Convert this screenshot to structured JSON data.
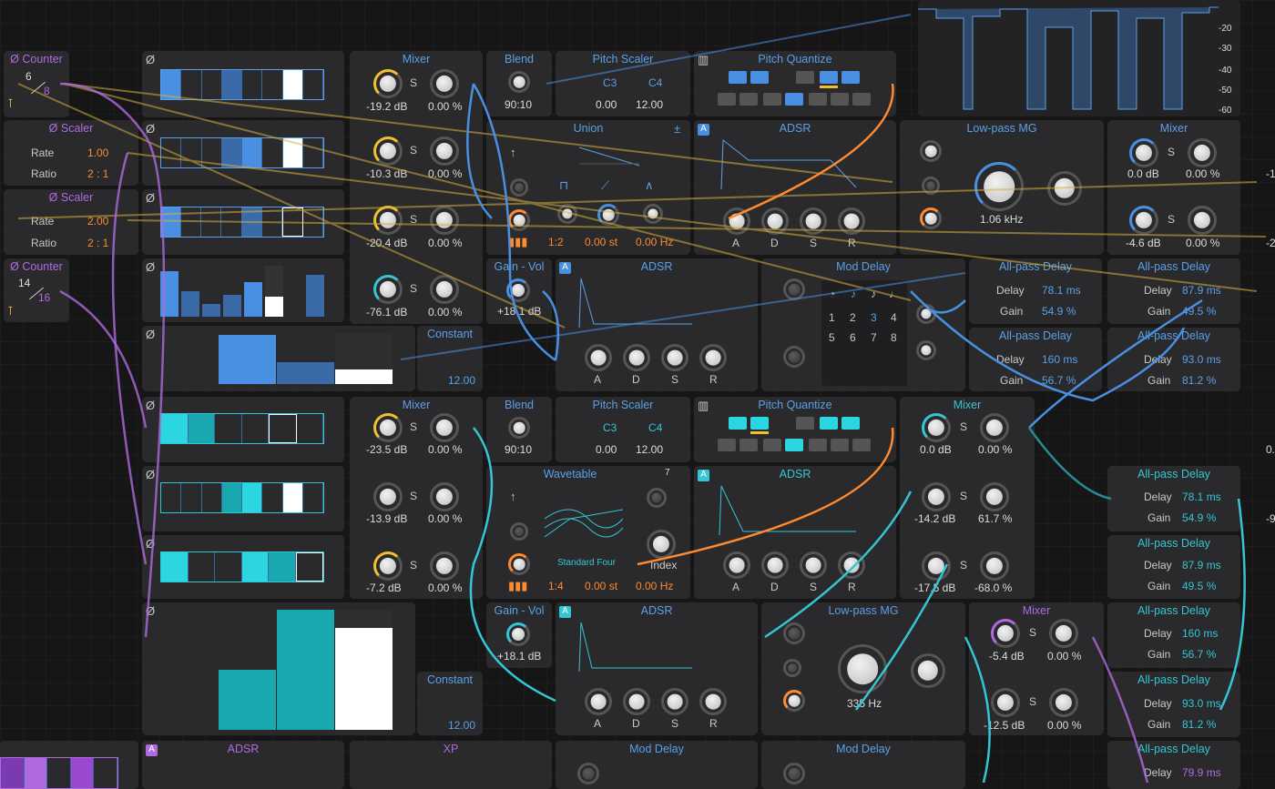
{
  "colors": {
    "background": "#161617",
    "panel": "#2a2a2c",
    "blue": "#5aa0e8",
    "cyan": "#34c6d4",
    "purple": "#b06ae0",
    "orange": "#ff8a30",
    "yellow": "#f0c030",
    "red": "#e03030"
  },
  "counter1": {
    "title": "Ø Counter",
    "top": "6",
    "bottom": "8"
  },
  "scaler1": {
    "title": "Ø Scaler",
    "rate_label": "Rate",
    "rate": "1.00",
    "ratio_label": "Ratio",
    "ratio": "2 : 1"
  },
  "scaler2": {
    "title": "Ø Scaler",
    "rate_label": "Rate",
    "rate": "2.00",
    "ratio_label": "Ratio",
    "ratio": "2 : 1"
  },
  "counter2": {
    "title": "Ø Counter",
    "top": "14",
    "bottom": "16"
  },
  "mixer1": {
    "title": "Mixer",
    "rows": [
      {
        "db": "-19.2 dB",
        "pct": "0.00 %"
      },
      {
        "db": "-10.3 dB",
        "pct": "0.00 %"
      },
      {
        "db": "-20.4 dB",
        "pct": "0.00 %"
      },
      {
        "db": "-76.1 dB",
        "pct": "0.00 %"
      }
    ]
  },
  "mixer2": {
    "title": "Mixer",
    "rows": [
      {
        "db": "-23.5 dB",
        "pct": "0.00 %"
      },
      {
        "db": "-13.9 dB",
        "pct": "0.00 %"
      },
      {
        "db": "-7.2 dB",
        "pct": "0.00 %"
      }
    ]
  },
  "blend1": {
    "title": "Blend",
    "value": "90:10"
  },
  "blend2": {
    "title": "Blend",
    "value": "90:10"
  },
  "pitchscaler1": {
    "title": "Pitch Scaler",
    "low": "C3",
    "high": "C4",
    "v1": "0.00",
    "v2": "12.00"
  },
  "pitchscaler2": {
    "title": "Pitch Scaler",
    "low": "C3",
    "high": "C4",
    "v1": "0.00",
    "v2": "12.00"
  },
  "pq1": {
    "title": "Pitch Quantize"
  },
  "pq2": {
    "title": "Pitch Quantize"
  },
  "union": {
    "title": "Union",
    "ratio": "1:2",
    "st": "0.00 st",
    "hz": "0.00 Hz"
  },
  "wavetable": {
    "title": "Wavetable",
    "table": "Standard Four",
    "index_label": "Index",
    "ratio": "1:4",
    "st": "0.00 st",
    "hz": "0.00 Hz",
    "count": "7"
  },
  "adsr1": {
    "title": "ADSR",
    "labels": [
      "A",
      "D",
      "S",
      "R"
    ]
  },
  "adsr2": {
    "title": "ADSR",
    "labels": [
      "A",
      "D",
      "S",
      "R"
    ]
  },
  "adsr3": {
    "title": "ADSR",
    "labels": [
      "A",
      "D",
      "S",
      "R"
    ]
  },
  "adsr4": {
    "title": "ADSR",
    "labels": [
      "A",
      "D",
      "S",
      "R"
    ]
  },
  "adsr5": {
    "title": "ADSR"
  },
  "lpmg1": {
    "title": "Low-pass MG",
    "freq": "1.06 kHz"
  },
  "lpmg2": {
    "title": "Low-pass MG",
    "freq": "335 Hz"
  },
  "mixer3": {
    "title": "Mixer",
    "rows": [
      {
        "db": "0.0 dB",
        "pct": "0.00 %"
      },
      {
        "db": "-4.6 dB",
        "pct": "0.00 %"
      }
    ]
  },
  "mixer4": {
    "title": "Mixer",
    "rows": [
      {
        "db": "0.0 dB",
        "pct": "0.00 %"
      },
      {
        "db": "-14.2 dB",
        "pct": "61.7 %"
      },
      {
        "db": "-17.5 dB",
        "pct": "-68.0 %"
      }
    ]
  },
  "mixer5": {
    "title": "Mixer",
    "rows": [
      {
        "db": "-5.4 dB",
        "pct": "0.00 %"
      },
      {
        "db": "-12.5 dB",
        "pct": "0.00 %"
      }
    ]
  },
  "gainvol1": {
    "title": "Gain - Vol",
    "value": "+18.1 dB"
  },
  "gainvol2": {
    "title": "Gain - Vol",
    "value": "+18.1 dB"
  },
  "constant1": {
    "title": "Constant",
    "value": "12.00"
  },
  "constant2": {
    "title": "Constant",
    "value": "12.00"
  },
  "moddelay1": {
    "title": "Mod Delay",
    "numbers": [
      "1",
      "2",
      "3",
      "4",
      "5",
      "6",
      "7",
      "8"
    ]
  },
  "moddelay2": {
    "title": "Mod Delay"
  },
  "moddelay3": {
    "title": "Mod Delay"
  },
  "xp": {
    "title": "XP"
  },
  "allpass": [
    {
      "title": "All-pass Delay",
      "delay": "78.1 ms",
      "gain": "54.9 %"
    },
    {
      "title": "All-pass Delay",
      "delay": "87.9 ms",
      "gain": "49.5 %"
    },
    {
      "title": "All-pass Delay",
      "delay": "160 ms",
      "gain": "56.7 %"
    },
    {
      "title": "All-pass Delay",
      "delay": "93.0 ms",
      "gain": "81.2 %"
    },
    {
      "title": "All-pass Delay",
      "delay": "78.1 ms",
      "gain": "54.9 %"
    },
    {
      "title": "All-pass Delay",
      "delay": "87.9 ms",
      "gain": "49.5 %"
    },
    {
      "title": "All-pass Delay",
      "delay": "160 ms",
      "gain": "56.7 %"
    },
    {
      "title": "All-pass Delay",
      "delay": "93.0 ms",
      "gain": "81.2 %"
    },
    {
      "title": "All-pass Delay",
      "delay": "79.9 ms"
    }
  ],
  "delay_label": "Delay",
  "gain_label": "Gain",
  "scope": {
    "ticks": [
      "-20",
      "-30",
      "-40",
      "-50",
      "-60"
    ]
  },
  "s_label": "S",
  "edge_values": [
    "-1",
    "-2",
    "0.",
    "-9"
  ]
}
